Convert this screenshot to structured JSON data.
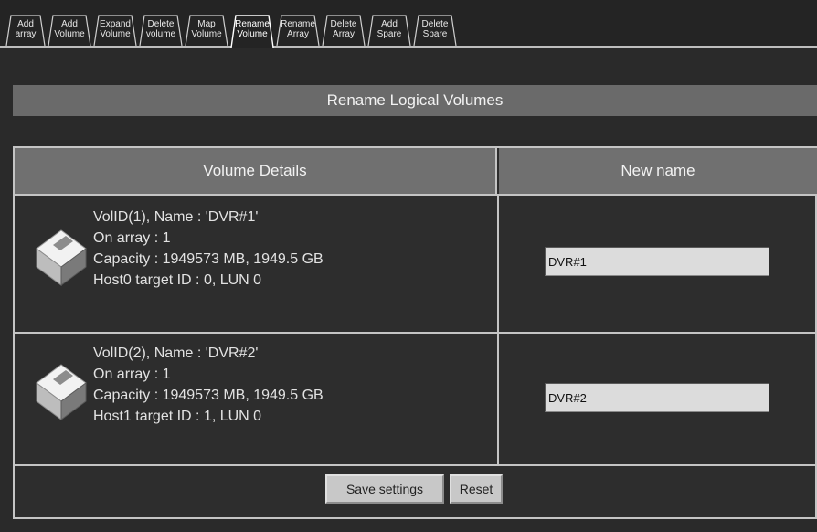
{
  "tabs": [
    {
      "line1": "Add",
      "line2": "array"
    },
    {
      "line1": "Add",
      "line2": "Volume"
    },
    {
      "line1": "Expand",
      "line2": "Volume"
    },
    {
      "line1": "Delete",
      "line2": "volume"
    },
    {
      "line1": "Map",
      "line2": "Volume"
    },
    {
      "line1": "Rename",
      "line2": "Volume",
      "active": true
    },
    {
      "line1": "Rename",
      "line2": "Array"
    },
    {
      "line1": "Delete",
      "line2": "Array"
    },
    {
      "line1": "Add",
      "line2": "Spare"
    },
    {
      "line1": "Delete",
      "line2": "Spare"
    }
  ],
  "page_title": "Rename Logical Volumes",
  "table": {
    "col_details": "Volume Details",
    "col_newname": "New name"
  },
  "volumes": [
    {
      "line1": "VolID(1), Name : 'DVR#1'",
      "line2": "On array : 1",
      "line3": "Capacity : 1949573 MB, 1949.5 GB",
      "line4": "Host0 target ID : 0, LUN 0",
      "new_name": "DVR#1"
    },
    {
      "line1": "VolID(2), Name : 'DVR#2'",
      "line2": "On array : 1",
      "line3": "Capacity : 1949573 MB, 1949.5 GB",
      "line4": "Host1 target ID : 1, LUN 0",
      "new_name": "DVR#2"
    }
  ],
  "buttons": {
    "save": "Save settings",
    "reset": "Reset"
  },
  "icons": {
    "volume": "disk-volume-icon"
  },
  "colors": {
    "background": "#2a2a2a",
    "header": "#707070",
    "border": "#c4c4c4",
    "input": "#dcdcdc",
    "button": "#c8c8c8"
  }
}
